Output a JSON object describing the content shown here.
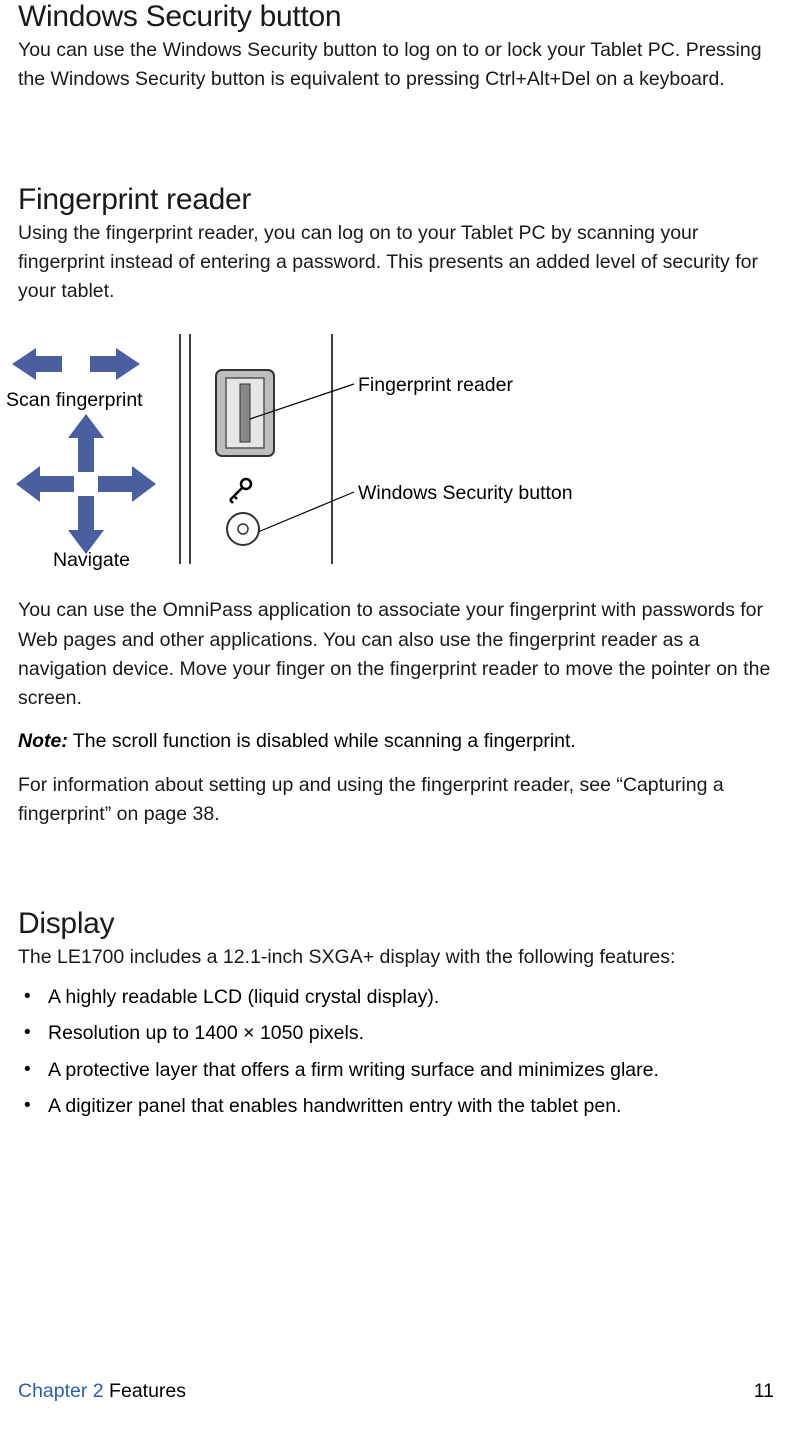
{
  "section1": {
    "heading": "Windows Security button",
    "paragraph": "You can use the Windows Security button to log on to or lock your Tablet PC. Pressing the Windows Security button is equivalent to pressing Ctrl+Alt+Del on a keyboard."
  },
  "section2": {
    "heading": "Fingerprint reader",
    "paragraph1": "Using the fingerprint reader, you can log on to your Tablet PC by scanning your fingerprint instead of entering a password. This presents an added level of security for your tablet.",
    "diagram": {
      "scan_label": "Scan fingerprint",
      "navigate_label": "Navigate",
      "fingerprint_reader_label": "Fingerprint reader",
      "windows_security_label": "Windows Security button"
    },
    "paragraph2": "You can use the OmniPass application to associate your fingerprint with passwords for Web pages and other applications. You can also use the fingerprint reader as a navigation device. Move your finger on the fingerprint reader to move the pointer on the screen.",
    "note_label": "Note:",
    "note_text": " The scroll function is disabled while scanning a fingerprint.",
    "paragraph3": "For information about setting up and using the fingerprint reader, see “Capturing a fingerprint” on page 38."
  },
  "section3": {
    "heading": "Display",
    "intro": "The LE1700 includes a 12.1-inch SXGA+ display with the following features:",
    "bullets": [
      "A highly readable LCD (liquid crystal display).",
      "Resolution up to 1400 × 1050 pixels.",
      "A protective layer that offers a firm writing surface and minimizes glare.",
      "A digitizer panel that enables handwritten entry with the tablet pen."
    ]
  },
  "footer": {
    "chapter_label": "Chapter 2",
    "chapter_name": "  Features",
    "page_number": "11"
  }
}
